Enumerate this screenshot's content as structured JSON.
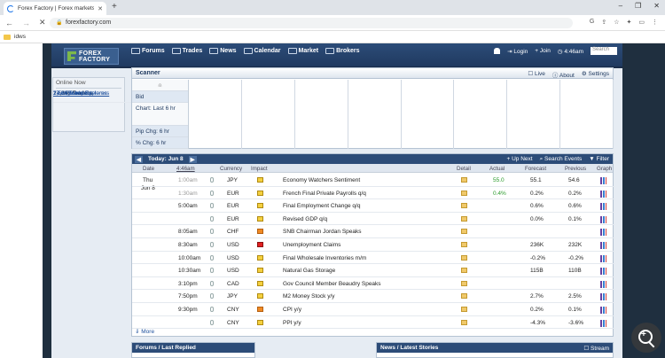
{
  "browser": {
    "tab_title": "Forex Factory | Forex markets for",
    "url": "forexfactory.com",
    "bookmark": "idws",
    "window_buttons": [
      "–",
      "❐",
      "✕"
    ]
  },
  "site": {
    "logo_top": "FOREX",
    "logo_bottom": "FACTORY",
    "menu": [
      {
        "label": "Forums",
        "icon": "chat-icon"
      },
      {
        "label": "Trades",
        "icon": "trades-icon"
      },
      {
        "label": "News",
        "icon": "globe-icon"
      },
      {
        "label": "Calendar",
        "icon": "calendar-icon"
      },
      {
        "label": "Market",
        "icon": "chart-icon"
      },
      {
        "label": "Brokers",
        "icon": "brokers-icon"
      }
    ],
    "login": "Login",
    "join": "Join",
    "time": "4:46am",
    "search_placeholder": "Search"
  },
  "online": {
    "header": "Online Now",
    "items": [
      "17,340 Traders",
      "2,516 Members",
      "17 High Impact",
      "24 w/ Trade Explorers",
      "7 w/ Posted Systems"
    ]
  },
  "scanner": {
    "title": "Scanner",
    "live": "Live",
    "about": "About",
    "settings": "Settings",
    "rows": [
      "Bid",
      "Chart: Last 6 hr",
      "Pip Chg: 6 hr",
      "% Chg: 6 hr"
    ]
  },
  "calendar": {
    "today_label": "Today: Jun 8",
    "up_next": "Up Next",
    "search_events": "Search Events",
    "filter": "Filter",
    "columns": {
      "date": "Date",
      "time": "4:46am",
      "currency": "Currency",
      "impact": "Impact",
      "detail": "Detail",
      "actual": "Actual",
      "forecast": "Forecast",
      "previous": "Previous",
      "graph": "Graph"
    },
    "date_day": "Thu",
    "date_date": "Jun 8",
    "events": [
      {
        "time": "1:00am",
        "cur": "JPY",
        "impact": "y",
        "event": "Economy Watchers Sentiment",
        "actual": "55.0",
        "forecast": "55.1",
        "previous": "54.6",
        "past": true
      },
      {
        "time": "1:30am",
        "cur": "EUR",
        "impact": "y",
        "event": "French Final Private Payrolls q/q",
        "actual": "0.4%",
        "forecast": "0.2%",
        "previous": "0.2%",
        "past": true
      },
      {
        "time": "5:00am",
        "cur": "EUR",
        "impact": "y",
        "event": "Final Employment Change q/q",
        "actual": "",
        "forecast": "0.6%",
        "previous": "0.6%",
        "past": false
      },
      {
        "time": "",
        "cur": "EUR",
        "impact": "y",
        "event": "Revised GDP q/q",
        "actual": "",
        "forecast": "0.0%",
        "previous": "0.1%",
        "past": false
      },
      {
        "time": "8:05am",
        "cur": "CHF",
        "impact": "o",
        "event": "SNB Chairman Jordan Speaks",
        "actual": "",
        "forecast": "",
        "previous": "",
        "past": false
      },
      {
        "time": "8:30am",
        "cur": "USD",
        "impact": "r",
        "event": "Unemployment Claims",
        "actual": "",
        "forecast": "236K",
        "previous": "232K",
        "past": false
      },
      {
        "time": "10:00am",
        "cur": "USD",
        "impact": "y",
        "event": "Final Wholesale Inventories m/m",
        "actual": "",
        "forecast": "-0.2%",
        "previous": "-0.2%",
        "past": false
      },
      {
        "time": "10:30am",
        "cur": "USD",
        "impact": "y",
        "event": "Natural Gas Storage",
        "actual": "",
        "forecast": "115B",
        "previous": "110B",
        "past": false
      },
      {
        "time": "3:10pm",
        "cur": "CAD",
        "impact": "y",
        "event": "Gov Council Member Beaudry Speaks",
        "actual": "",
        "forecast": "",
        "previous": "",
        "past": false
      },
      {
        "time": "7:50pm",
        "cur": "JPY",
        "impact": "y",
        "event": "M2 Money Stock y/y",
        "actual": "",
        "forecast": "2.7%",
        "previous": "2.5%",
        "past": false
      },
      {
        "time": "9:30pm",
        "cur": "CNY",
        "impact": "o",
        "event": "CPI y/y",
        "actual": "",
        "forecast": "0.2%",
        "previous": "0.1%",
        "past": false
      },
      {
        "time": "",
        "cur": "CNY",
        "impact": "y",
        "event": "PPI y/y",
        "actual": "",
        "forecast": "-4.3%",
        "previous": "-3.6%",
        "past": false
      }
    ],
    "more": "More"
  },
  "bottom": {
    "forums_title": "Forums / Last Replied",
    "news_title": "News / Latest Stories",
    "stream": "Stream"
  },
  "colors": {
    "nav_blue": "#2c4c78",
    "impact_yellow": "#f4d03f",
    "impact_orange": "#f08a24",
    "impact_red": "#e02020",
    "actual_green": "#2a9a2a"
  }
}
